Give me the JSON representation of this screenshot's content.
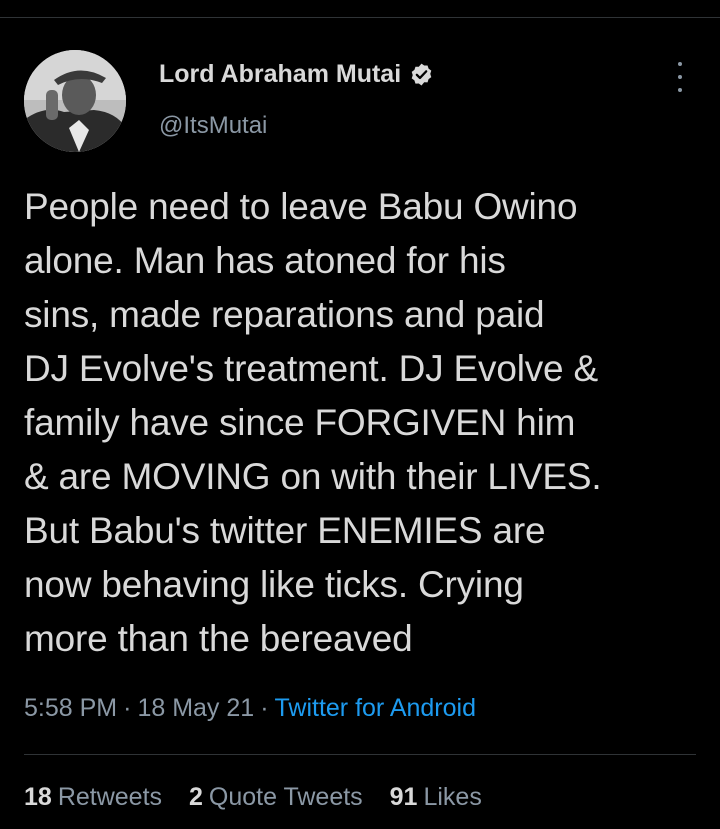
{
  "tweet": {
    "author": {
      "name": "Lord Abraham Mutai",
      "handle": "@ItsMutai",
      "verified": true
    },
    "text": "People need to leave Babu Owino\nalone. Man has atoned for his\nsins, made reparations and paid\nDJ Evolve's treatment. DJ Evolve &\nfamily have since FORGIVEN him\n& are MOVING on with their LIVES.\nBut Babu's twitter ENEMIES are\nnow behaving like ticks. Crying\nmore than the bereaved",
    "time": "5:58 PM",
    "date": "18 May 21",
    "separator": "·",
    "source": "Twitter for Android",
    "stats": {
      "retweets_count": "18",
      "retweets_label": "Retweets",
      "quotes_count": "2",
      "quotes_label": "Quote Tweets",
      "likes_count": "91",
      "likes_label": "Likes"
    }
  },
  "icons": {
    "verified": "verified-badge-icon",
    "more": "more-options-icon"
  },
  "colors": {
    "background": "#000000",
    "text": "#d9d9d9",
    "secondary": "#8b98a5",
    "link": "#1d9bf0",
    "divider": "#2f3336"
  }
}
